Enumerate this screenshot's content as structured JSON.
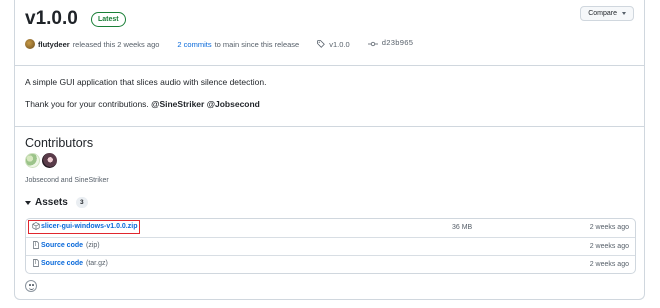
{
  "release": {
    "version": "v1.0.0",
    "latest_badge": "Latest",
    "compare_label": "Compare",
    "author": "flutydeer",
    "released_text": "released this 2 weeks ago",
    "commits_link": "2 commits",
    "commits_suffix": "to main since this release",
    "tag": "v1.0.0",
    "commit_hash": "d23b965"
  },
  "notes": {
    "line1": "A simple GUI application that slices audio with silence detection.",
    "thanks_prefix": "Thank you for your contributions.",
    "mention1": "@SineStriker",
    "mention2": "@Jobsecond"
  },
  "contributors": {
    "title": "Contributors",
    "names": "Jobsecond and SineStriker"
  },
  "assets": {
    "label": "Assets",
    "count": "3",
    "rows": [
      {
        "name": "slicer-gui-windows-v1.0.0.zip",
        "sub": "",
        "size": "36 MB",
        "date": "2 weeks ago"
      },
      {
        "name": "Source code",
        "sub": "(zip)",
        "size": "",
        "date": "2 weeks ago"
      },
      {
        "name": "Source code",
        "sub": "(tar.gz)",
        "size": "",
        "date": "2 weeks ago"
      }
    ]
  },
  "colors": {
    "link": "#0969da",
    "latest_green": "#1a7f37",
    "highlight_red": "#e0262e"
  },
  "icons": [
    "tag-icon",
    "commit-icon",
    "package-icon",
    "file-zip-icon",
    "smiley-icon",
    "triangle-down-icon"
  ]
}
